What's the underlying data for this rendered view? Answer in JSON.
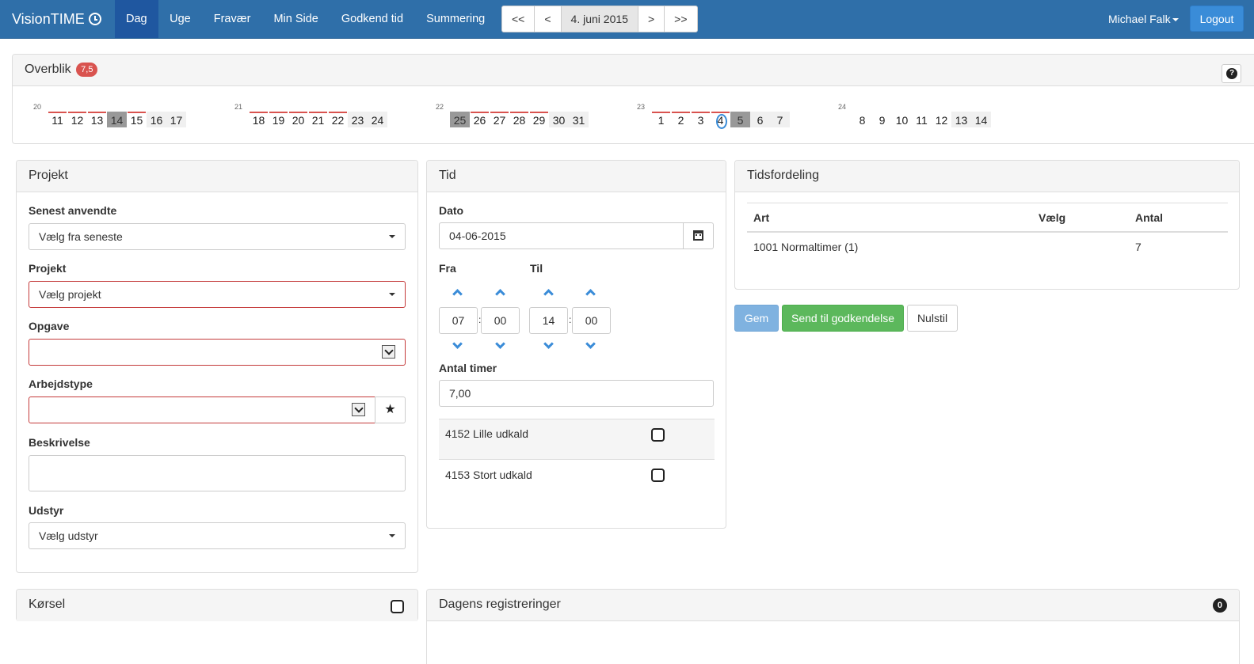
{
  "brand": "VisionTIME",
  "nav": [
    "Dag",
    "Uge",
    "Fravær",
    "Min Side",
    "Godkend tid",
    "Summering"
  ],
  "datenav": {
    "first": "<<",
    "prev": "<",
    "current": "4. juni 2015",
    "next": ">",
    "last": ">>"
  },
  "user": "Michael Falk",
  "logout": "Logout",
  "overview": {
    "title": "Overblik",
    "badge": "7,5",
    "weeks": [
      {
        "week": "20",
        "days": [
          "11",
          "12",
          "13",
          "14",
          "15",
          "16",
          "17"
        ]
      },
      {
        "week": "21",
        "days": [
          "18",
          "19",
          "20",
          "21",
          "22",
          "23",
          "24"
        ]
      },
      {
        "week": "22",
        "days": [
          "25",
          "26",
          "27",
          "28",
          "29",
          "30",
          "31"
        ]
      },
      {
        "week": "23",
        "days": [
          "1",
          "2",
          "3",
          "4",
          "5",
          "6",
          "7"
        ]
      },
      {
        "week": "24",
        "days": [
          "8",
          "9",
          "10",
          "11",
          "12",
          "13",
          "14"
        ]
      }
    ]
  },
  "projekt": {
    "title": "Projekt",
    "senest_label": "Senest anvendte",
    "senest_value": "Vælg fra seneste",
    "projekt_label": "Projekt",
    "projekt_value": "Vælg projekt",
    "opgave_label": "Opgave",
    "opgave_value": "",
    "arbejdstype_label": "Arbejdstype",
    "arbejdstype_value": "",
    "star": "★",
    "beskrivelse_label": "Beskrivelse",
    "beskrivelse_value": "",
    "udstyr_label": "Udstyr",
    "udstyr_value": "Vælg udstyr"
  },
  "tid": {
    "title": "Tid",
    "dato_label": "Dato",
    "dato_value": "04-06-2015",
    "fra_label": "Fra",
    "til_label": "Til",
    "fra_h": "07",
    "fra_m": "00",
    "til_h": "14",
    "til_m": "00",
    "colon": ":",
    "antal_label": "Antal timer",
    "antal_value": "7,00",
    "tillaeg": [
      "4152 Lille udkald",
      "4153 Stort udkald"
    ]
  },
  "tidsfordeling": {
    "title": "Tidsfordeling",
    "headers": [
      "Art",
      "Vælg",
      "Antal"
    ],
    "rows": [
      {
        "art": "1001 Normaltimer (1)",
        "vaelg": "",
        "antal": "7"
      }
    ]
  },
  "buttons": {
    "gem": "Gem",
    "send": "Send til godkendelse",
    "nulstil": "Nulstil"
  },
  "korsel": {
    "title": "Kørsel"
  },
  "dagens": {
    "title": "Dagens registreringer",
    "count": "0"
  }
}
